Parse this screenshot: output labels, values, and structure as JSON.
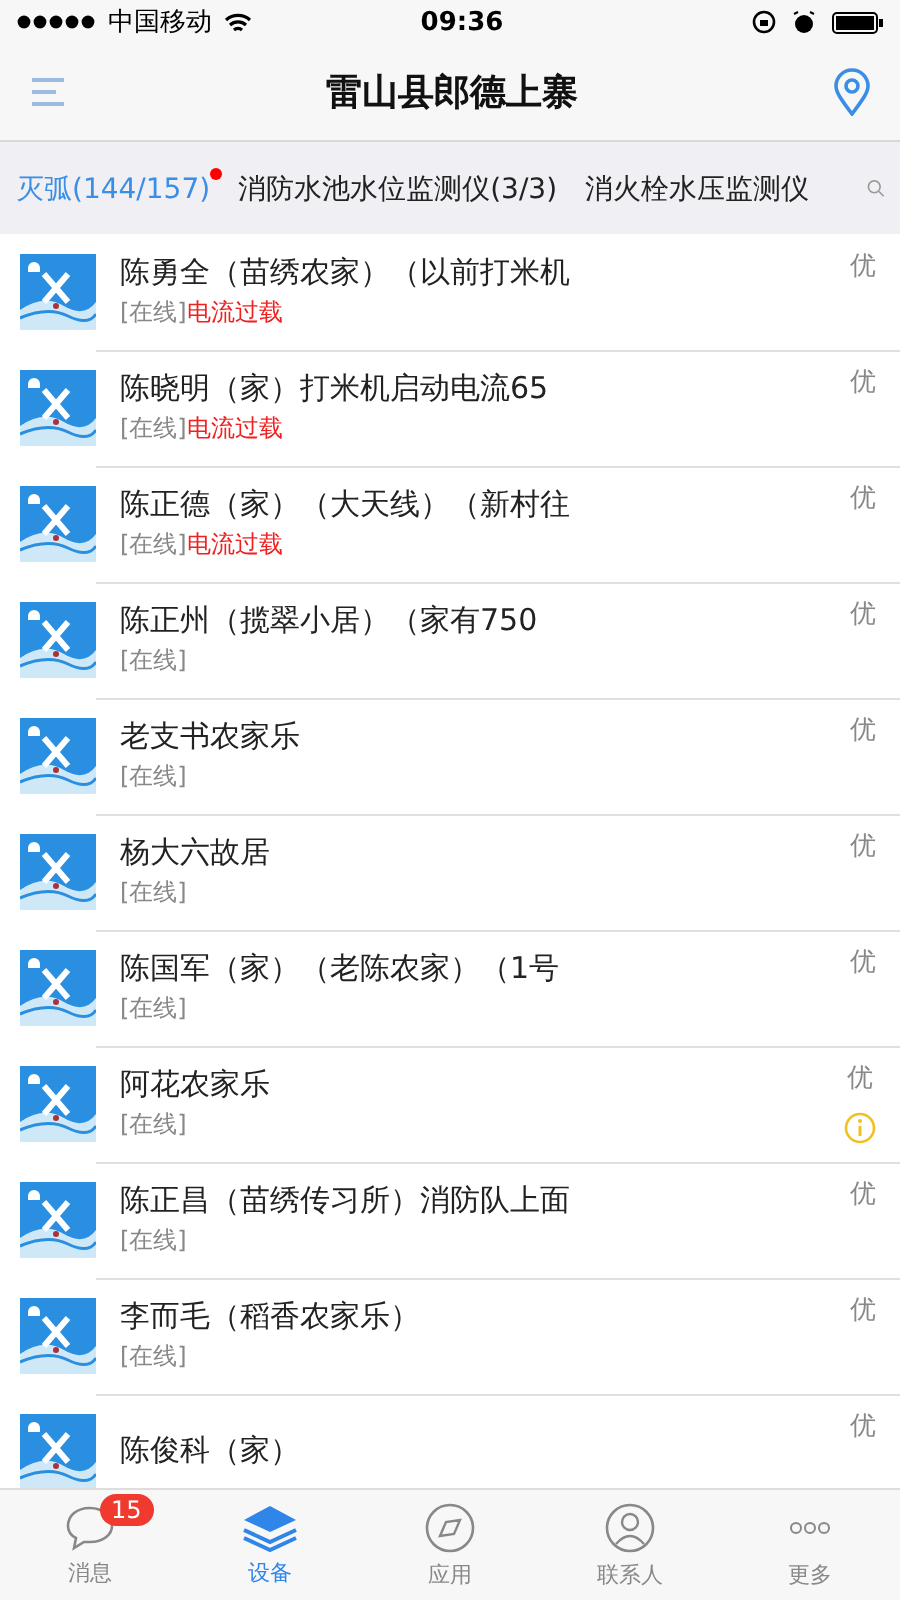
{
  "status_bar": {
    "carrier": "中国移动",
    "time": "09:36"
  },
  "nav": {
    "title": "雷山县郎德上寨"
  },
  "categories": [
    {
      "label": "灭弧(144/157)",
      "selected": true,
      "dot": true
    },
    {
      "label": "消防水池水位监测仪(3/3)",
      "selected": false,
      "dot": false
    },
    {
      "label": "消火栓水压监测仪",
      "selected": false,
      "dot": false
    }
  ],
  "devices": [
    {
      "name": "陈勇全（苗绣农家）（以前打米机",
      "status": "[在线]",
      "alert": "电流过载",
      "grade": "优",
      "info": false
    },
    {
      "name": "陈晓明（家）打米机启动电流65",
      "status": "[在线]",
      "alert": "电流过载",
      "grade": "优",
      "info": false
    },
    {
      "name": "陈正德（家）（大天线）（新村往",
      "status": "[在线]",
      "alert": "电流过载",
      "grade": "优",
      "info": false
    },
    {
      "name": "陈正州（揽翠小居）（家有750",
      "status": "[在线]",
      "grade": "优",
      "info": false
    },
    {
      "name": "老支书农家乐",
      "status": "[在线]",
      "grade": "优",
      "info": false
    },
    {
      "name": "杨大六故居",
      "status": "[在线]",
      "grade": "优",
      "info": false
    },
    {
      "name": "陈国军（家）（老陈农家）（1号",
      "status": "[在线]",
      "grade": "优",
      "info": false
    },
    {
      "name": "阿花农家乐",
      "status": "[在线]",
      "grade": "优",
      "info": true
    },
    {
      "name": "陈正昌（苗绣传习所）消防队上面",
      "status": "[在线]",
      "grade": "优",
      "info": false
    },
    {
      "name": "李而毛（稻香农家乐）",
      "status": "[在线]",
      "grade": "优",
      "info": false
    },
    {
      "name": "陈俊科（家）",
      "grade": "优",
      "info": false
    }
  ],
  "tab_bar": [
    {
      "kind": "chat",
      "label": "消息",
      "selected": false,
      "badge": "15"
    },
    {
      "kind": "layers",
      "label": "设备",
      "selected": true
    },
    {
      "kind": "compass",
      "label": "应用",
      "selected": false
    },
    {
      "kind": "contacts",
      "label": "联系人",
      "selected": false
    },
    {
      "kind": "more",
      "label": "更多",
      "selected": false
    }
  ]
}
